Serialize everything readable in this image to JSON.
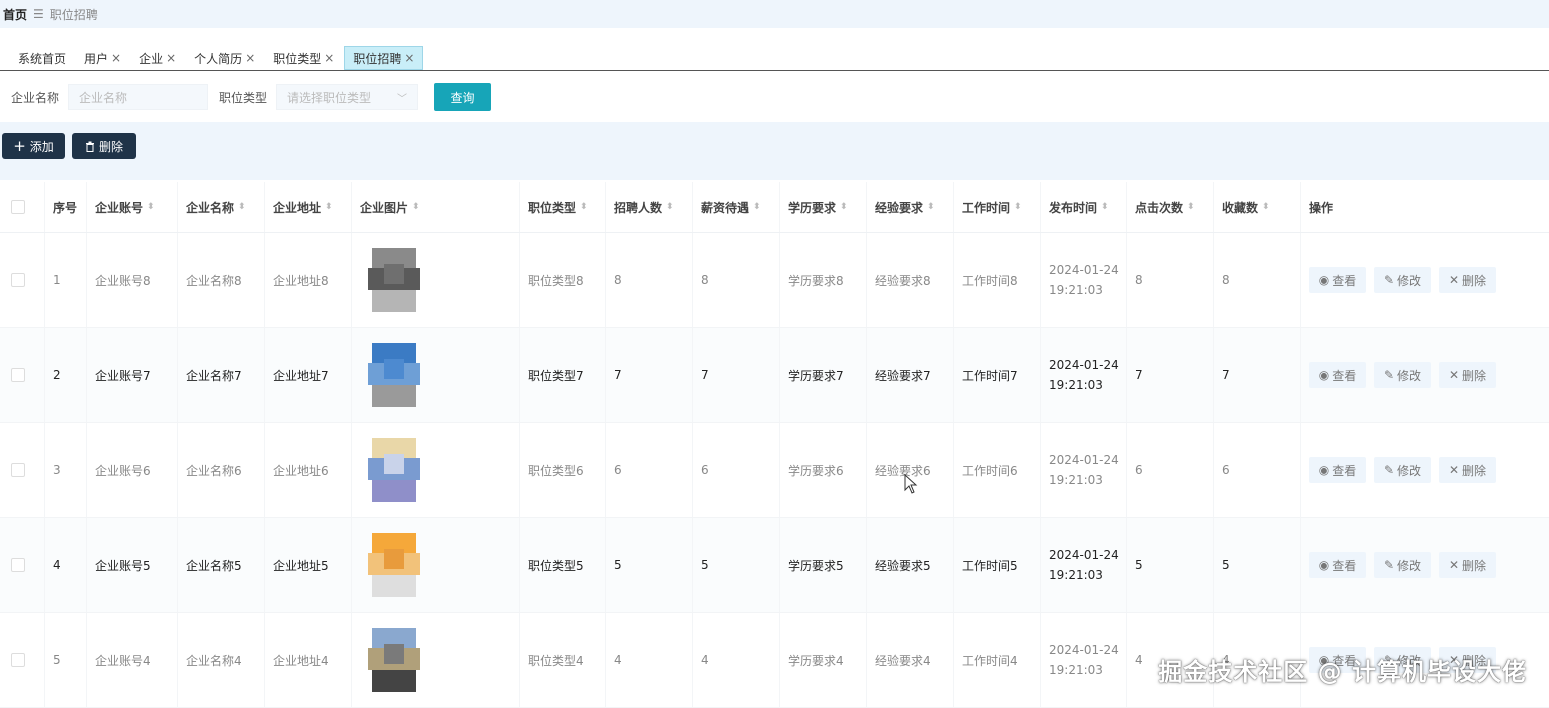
{
  "breadcrumb": {
    "home": "首页",
    "current": "职位招聘"
  },
  "tabs": [
    {
      "label": "系统首页",
      "closable": false,
      "active": false
    },
    {
      "label": "用户",
      "closable": true,
      "active": false
    },
    {
      "label": "企业",
      "closable": true,
      "active": false
    },
    {
      "label": "个人简历",
      "closable": true,
      "active": false
    },
    {
      "label": "职位类型",
      "closable": true,
      "active": false
    },
    {
      "label": "职位招聘",
      "closable": true,
      "active": true
    }
  ],
  "search": {
    "company_label": "企业名称",
    "company_placeholder": "企业名称",
    "type_label": "职位类型",
    "type_placeholder": "请选择职位类型",
    "query_button": "查询"
  },
  "actions": {
    "add": "添加",
    "delete": "删除"
  },
  "columns": [
    "序号",
    "企业账号",
    "企业名称",
    "企业地址",
    "企业图片",
    "职位类型",
    "招聘人数",
    "薪资待遇",
    "学历要求",
    "经验要求",
    "工作时间",
    "发布时间",
    "点击次数",
    "收藏数",
    "操作"
  ],
  "row_actions": {
    "view": "查看",
    "edit": "修改",
    "delete": "删除"
  },
  "rows": [
    {
      "idx": "1",
      "account": "企业账号8",
      "name": "企业名称8",
      "address": "企业地址8",
      "type": "职位类型8",
      "count": "8",
      "salary": "8",
      "education": "学历要求8",
      "experience": "经验要求8",
      "worktime": "工作时间8",
      "date": "2024-01-24",
      "time": "19:21:03",
      "clicks": "8",
      "favs": "8"
    },
    {
      "idx": "2",
      "account": "企业账号7",
      "name": "企业名称7",
      "address": "企业地址7",
      "type": "职位类型7",
      "count": "7",
      "salary": "7",
      "education": "学历要求7",
      "experience": "经验要求7",
      "worktime": "工作时间7",
      "date": "2024-01-24",
      "time": "19:21:03",
      "clicks": "7",
      "favs": "7"
    },
    {
      "idx": "3",
      "account": "企业账号6",
      "name": "企业名称6",
      "address": "企业地址6",
      "type": "职位类型6",
      "count": "6",
      "salary": "6",
      "education": "学历要求6",
      "experience": "经验要求6",
      "worktime": "工作时间6",
      "date": "2024-01-24",
      "time": "19:21:03",
      "clicks": "6",
      "favs": "6"
    },
    {
      "idx": "4",
      "account": "企业账号5",
      "name": "企业名称5",
      "address": "企业地址5",
      "type": "职位类型5",
      "count": "5",
      "salary": "5",
      "education": "学历要求5",
      "experience": "经验要求5",
      "worktime": "工作时间5",
      "date": "2024-01-24",
      "time": "19:21:03",
      "clicks": "5",
      "favs": "5"
    },
    {
      "idx": "5",
      "account": "企业账号4",
      "name": "企业名称4",
      "address": "企业地址4",
      "type": "职位类型4",
      "count": "4",
      "salary": "4",
      "education": "学历要求4",
      "experience": "经验要求4",
      "worktime": "工作时间4",
      "date": "2024-01-24",
      "time": "19:21:03",
      "clicks": "4",
      "favs": "4"
    }
  ],
  "watermark": "掘金技术社区 @ 计算机毕设大佬",
  "colors": {
    "accent": "#17a5b8",
    "dark_button": "#1f3348",
    "band": "#eef5fc"
  }
}
